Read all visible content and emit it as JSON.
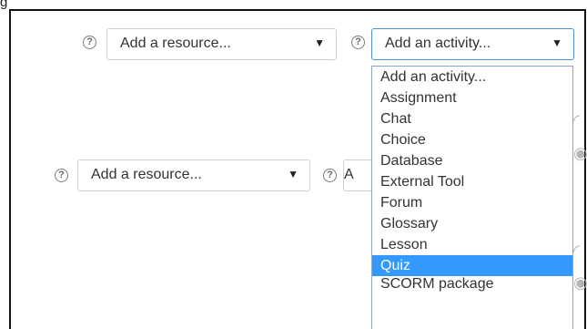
{
  "figure_label": "g",
  "row1": {
    "resource_select": {
      "label": "Add a resource...",
      "arrow": "▼"
    },
    "activity_select": {
      "label": "Add an activity...",
      "arrow": "▼"
    },
    "help_glyph": "?"
  },
  "row2": {
    "resource_select": {
      "label": "Add a resource...",
      "arrow": "▼"
    },
    "activity_select_partial": {
      "label": "A"
    },
    "help_glyph": "?"
  },
  "dropdown": {
    "options": [
      "Add an activity...",
      "Assignment",
      "Chat",
      "Choice",
      "Database",
      "External Tool",
      "Forum",
      "Glossary",
      "Lesson",
      "Quiz",
      "SCORM package"
    ],
    "selected_index": 9
  },
  "colors": {
    "selected_bg": "#3399ff",
    "focus_border": "#4a90d9",
    "frame_border": "#111111"
  },
  "icons": {
    "help": "help-circle-icon",
    "dropdown_arrow": "triangle-down-icon"
  }
}
